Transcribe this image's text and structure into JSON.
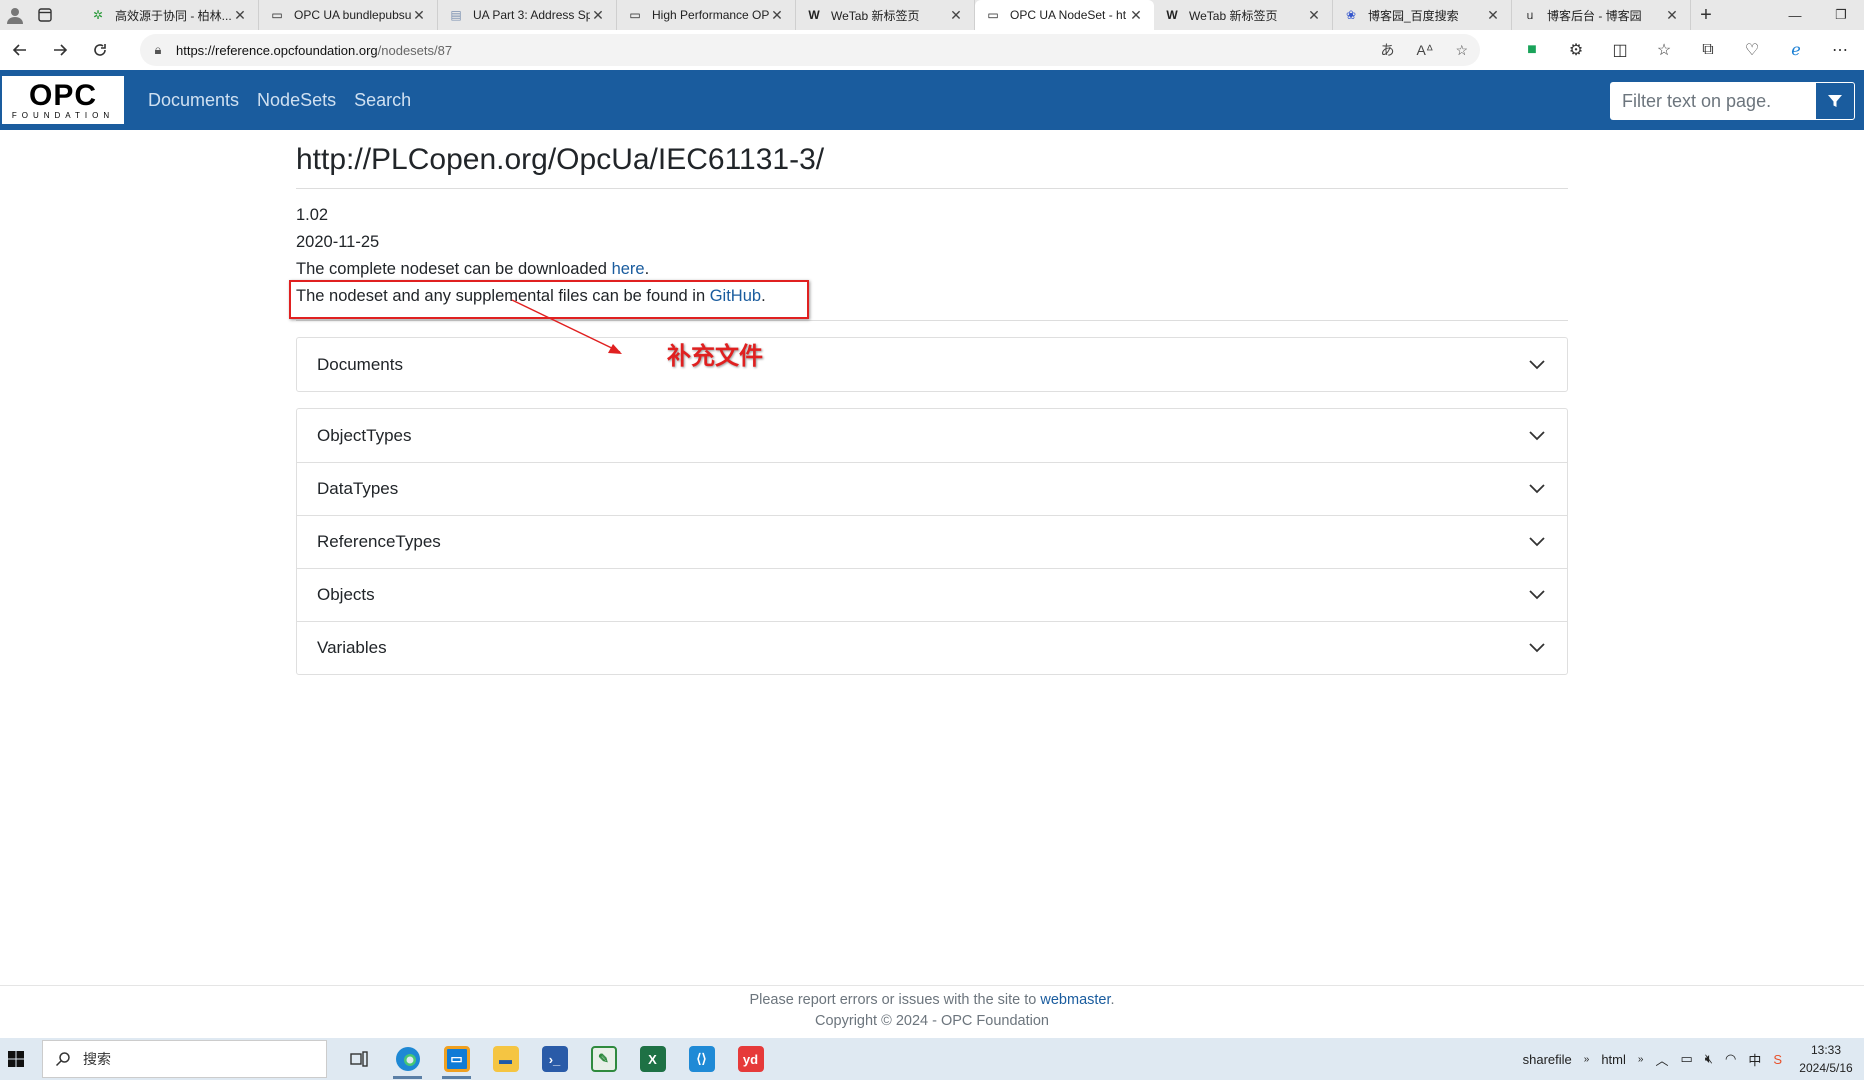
{
  "browser": {
    "tabs": [
      {
        "title": "高效源于协同 - 柏林...",
        "icon": "gear-green-icon",
        "active": false
      },
      {
        "title": "OPC UA bundlepubsu",
        "icon": "page-icon",
        "active": false
      },
      {
        "title": "UA Part 3: Address Sp",
        "icon": "doc-icon",
        "active": false
      },
      {
        "title": "High Performance OP",
        "icon": "page-icon",
        "active": false
      },
      {
        "title": "WeTab 新标签页",
        "icon": "wetab-icon",
        "active": false
      },
      {
        "title": "OPC UA NodeSet - ht",
        "icon": "page-icon",
        "active": true
      },
      {
        "title": "WeTab 新标签页",
        "icon": "wetab-icon",
        "active": false
      },
      {
        "title": "博客园_百度搜索",
        "icon": "baidu-icon",
        "active": false
      },
      {
        "title": "博客后台 - 博客园",
        "icon": "cnblogs-icon",
        "active": false
      }
    ],
    "url_domain": "https://reference.opcfoundation.org",
    "url_path": "/nodesets/87"
  },
  "site": {
    "logo_text": "OPC",
    "logo_sub": "FOUNDATION",
    "nav": [
      "Documents",
      "NodeSets",
      "Search"
    ],
    "filter_placeholder": "Filter text on page."
  },
  "page": {
    "title": "http://PLCopen.org/OpcUa/IEC61131-3/",
    "version": "1.02",
    "date": "2020-11-25",
    "download_prefix": "The complete nodeset can be downloaded ",
    "download_link": "here",
    "download_suffix": ".",
    "github_prefix": "The nodeset and any supplemental files can be found in ",
    "github_link": "GitHub",
    "github_suffix": "."
  },
  "accordions": {
    "documents": "Documents",
    "sections": [
      "ObjectTypes",
      "DataTypes",
      "ReferenceTypes",
      "Objects",
      "Variables"
    ]
  },
  "annotation": {
    "text": "补充文件",
    "color": "#e02020"
  },
  "footer": {
    "line1_prefix": "Please report errors or issues with the site to ",
    "line1_link": "webmaster",
    "line1_suffix": ".",
    "line2": "Copyright © 2024 - OPC Foundation"
  },
  "taskbar": {
    "search_placeholder": "搜索",
    "apps": [
      "edge",
      "remote-desktop",
      "file-explorer",
      "powershell",
      "notepad",
      "excel",
      "vscode",
      "youdao"
    ],
    "tray_items": [
      "sharefile",
      "html"
    ],
    "time": "13:33",
    "date": "2024/5/16"
  },
  "colors": {
    "navbar": "#1a5c9e",
    "link": "#1a5c9e",
    "annotation": "#e02020"
  }
}
